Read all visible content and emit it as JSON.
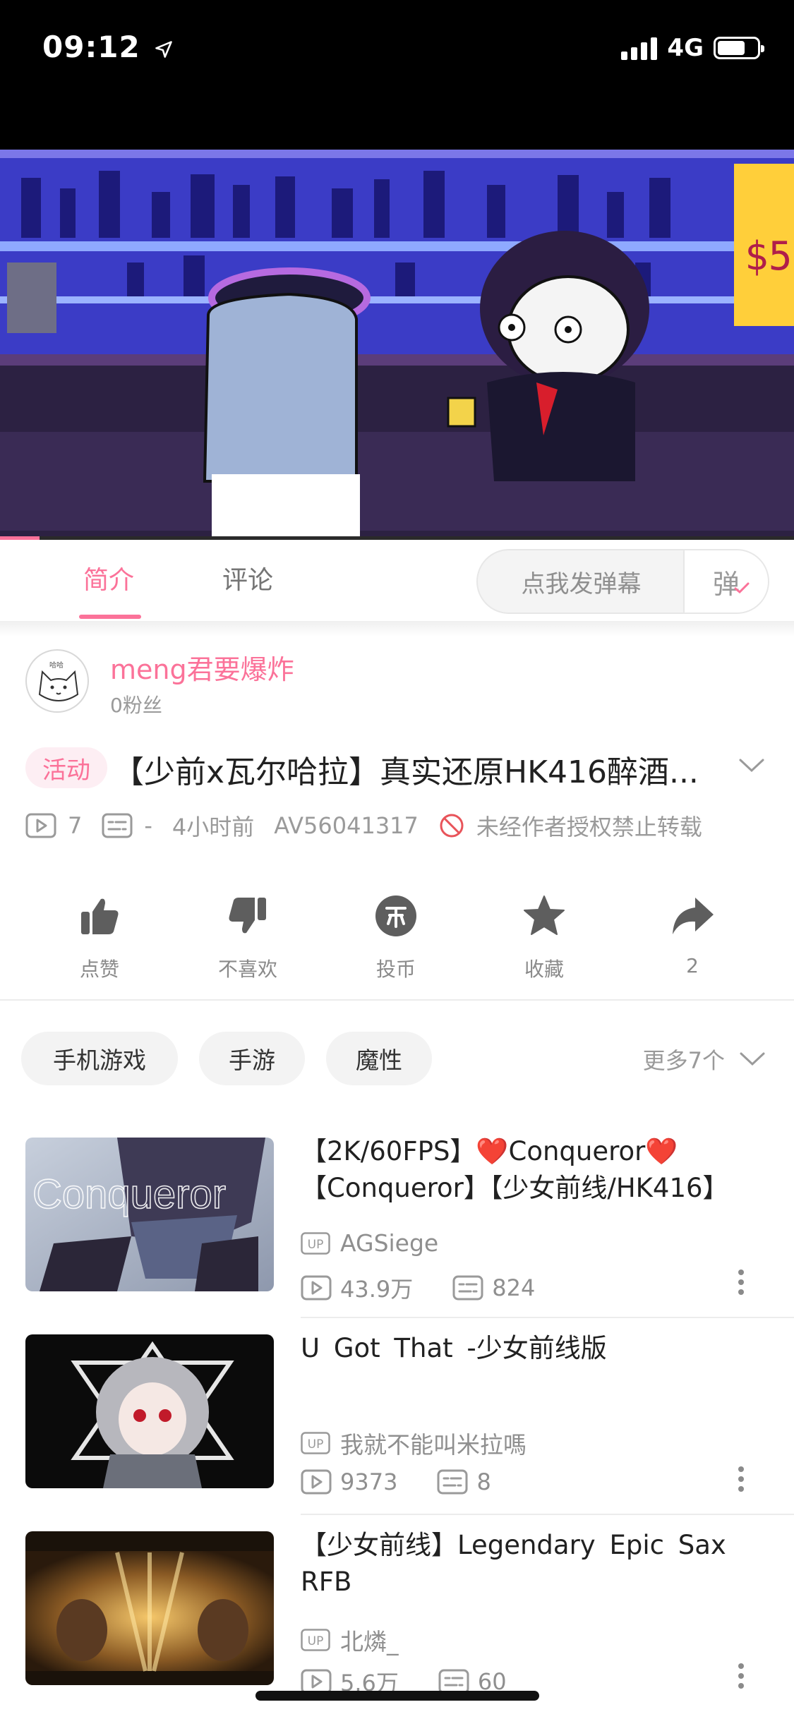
{
  "status_bar": {
    "time": "09:12",
    "network": "4G",
    "battery_level": 0.7
  },
  "player": {
    "progress": 0.05
  },
  "tabs": [
    {
      "label": "简介",
      "active": true
    },
    {
      "label": "评论",
      "active": false
    }
  ],
  "danmaku": {
    "placeholder": "点我发弹幕",
    "toggle_label": "弹"
  },
  "uploader": {
    "name": "meng君要爆炸",
    "fans": "0粉丝"
  },
  "video": {
    "badge": "活动",
    "title": "【少前x瓦尔哈拉】真实还原HK416醉酒...",
    "views": "7",
    "danmaku_count": "-",
    "time_ago": "4小时前",
    "av_id": "AV56041317",
    "copyright_notice": "未经作者授权禁止转载"
  },
  "actions": [
    {
      "icon": "like-icon",
      "label": "点赞"
    },
    {
      "icon": "dislike-icon",
      "label": "不喜欢"
    },
    {
      "icon": "coin-icon",
      "label": "投币"
    },
    {
      "icon": "star-icon",
      "label": "收藏"
    },
    {
      "icon": "share-icon",
      "label": "2"
    }
  ],
  "tags": [
    "手机游戏",
    "手游",
    "魔性"
  ],
  "more_tags": "更多7个",
  "related": [
    {
      "title": "【2K/60FPS】❤️Conqueror❤️【Conqueror】【少女前线/HK416】",
      "uploader": "AGSiege",
      "views": "43.9万",
      "danmaku": "824",
      "thumb_text": "Conqueror"
    },
    {
      "title": "U Got That -少女前线版",
      "uploader": "我就不能叫米拉嗎",
      "views": "9373",
      "danmaku": "8"
    },
    {
      "title": "【少女前线】Legendary Epic Sax RFB",
      "uploader": "北燐_",
      "views": "5.6万",
      "danmaku": "60"
    }
  ],
  "colors": {
    "accent": "#fb7299",
    "text": "#212121",
    "secondary": "#9a9a9a"
  }
}
